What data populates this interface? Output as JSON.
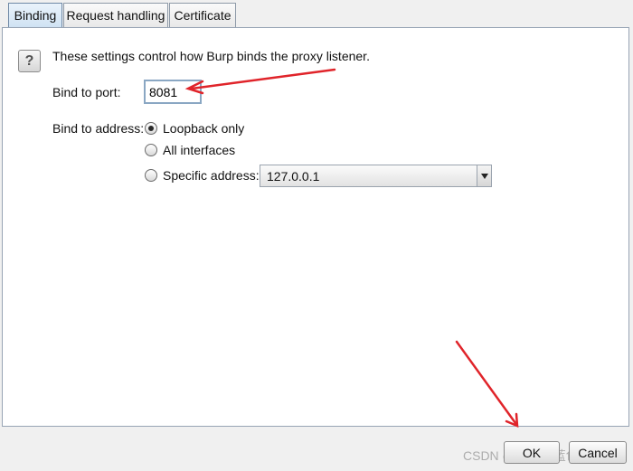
{
  "tabs": [
    {
      "label": "Binding",
      "active": true
    },
    {
      "label": "Request handling",
      "active": false
    },
    {
      "label": "Certificate",
      "active": false
    }
  ],
  "help_icon": "question-mark-icon",
  "intro_text": "These settings control how Burp binds the proxy listener.",
  "port": {
    "label": "Bind to port:",
    "value": "8081"
  },
  "address": {
    "label": "Bind to address:",
    "options": [
      {
        "label": "Loopback only",
        "selected": true
      },
      {
        "label": "All interfaces",
        "selected": false
      },
      {
        "label": "Specific address:",
        "selected": false
      }
    ],
    "specific_value": "127.0.0.1"
  },
  "buttons": {
    "ok": "OK",
    "cancel": "Cancel"
  },
  "watermark": "CSDN @迷失的蓝色小恐龙",
  "colors": {
    "annotation_arrow": "#e0242a",
    "active_tab": "#cfe2f3"
  }
}
